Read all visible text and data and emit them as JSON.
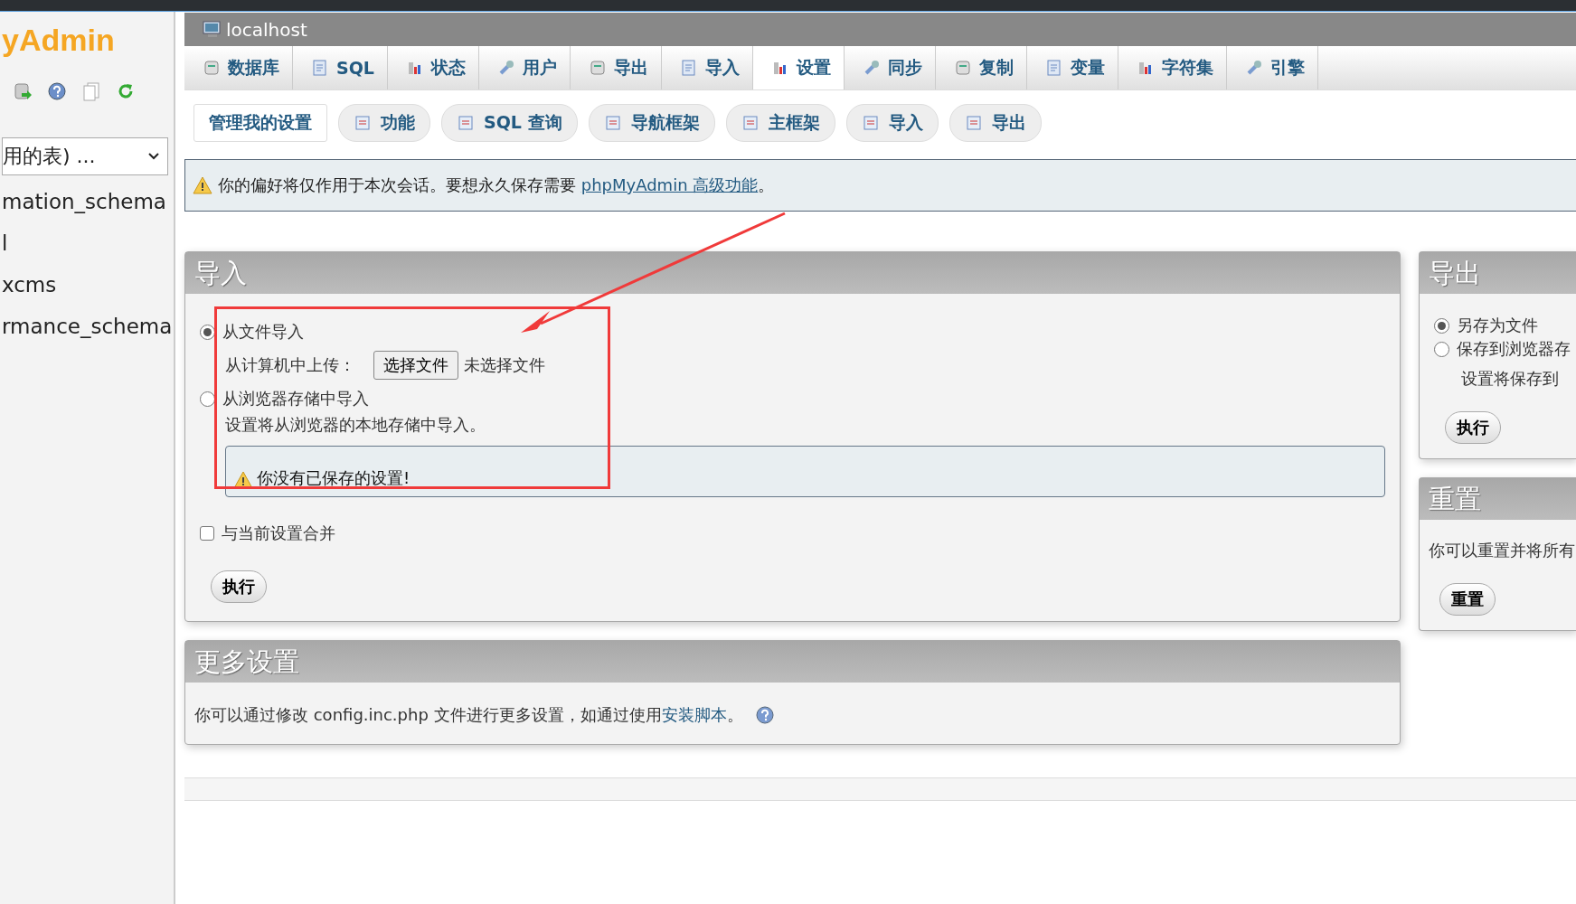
{
  "sidebar": {
    "logo": "yAdmin",
    "db_select": "用的表) ...",
    "databases": [
      "mation_schema",
      "l",
      "xcms",
      "rmance_schema"
    ]
  },
  "header": {
    "server": "localhost"
  },
  "tabs": [
    {
      "label": "数据库",
      "selected": false
    },
    {
      "label": "SQL",
      "selected": false
    },
    {
      "label": "状态",
      "selected": false
    },
    {
      "label": "用户",
      "selected": false
    },
    {
      "label": "导出",
      "selected": false
    },
    {
      "label": "导入",
      "selected": false
    },
    {
      "label": "设置",
      "selected": true
    },
    {
      "label": "同步",
      "selected": false
    },
    {
      "label": "复制",
      "selected": false
    },
    {
      "label": "变量",
      "selected": false
    },
    {
      "label": "字符集",
      "selected": false
    },
    {
      "label": "引擎",
      "selected": false
    }
  ],
  "subtabs": [
    {
      "label": "管理我的设置",
      "selected": true
    },
    {
      "label": "功能",
      "selected": false
    },
    {
      "label": "SQL 查询",
      "selected": false
    },
    {
      "label": "导航框架",
      "selected": false
    },
    {
      "label": "主框架",
      "selected": false
    },
    {
      "label": "导入",
      "selected": false
    },
    {
      "label": "导出",
      "selected": false
    }
  ],
  "notice": {
    "text": "你的偏好将仅作用于本次会话。要想永久保存需要 ",
    "link": "phpMyAdmin 高级功能",
    "end": "。"
  },
  "import_panel": {
    "title": "导入",
    "options": [
      {
        "label": "从文件导入",
        "selected": true
      },
      {
        "label": "从浏览器存储中导入",
        "selected": false
      }
    ],
    "upload_label": "从计算机中上传：",
    "file_button": "选择文件",
    "file_status": "未选择文件",
    "storage_desc": "设置将从浏览器的本地存储中导入。",
    "warning": "你没有已保存的设置!",
    "merge": {
      "label": "与当前设置合并",
      "checked": false
    },
    "submit": "执行"
  },
  "more_settings": {
    "title": "更多设置",
    "text": "你可以通过修改 config.inc.php 文件进行更多设置，如通过使用",
    "link": "安装脚本",
    "end": "。"
  },
  "export_panel": {
    "title": "导出",
    "options": [
      {
        "label": "另存为文件",
        "selected": true
      },
      {
        "label": "保存到浏览器存",
        "selected": false
      }
    ],
    "desc": "设置将保存到",
    "submit": "执行"
  },
  "reset_panel": {
    "title": "重置",
    "text": "你可以重置并将所有",
    "button": "重置"
  }
}
